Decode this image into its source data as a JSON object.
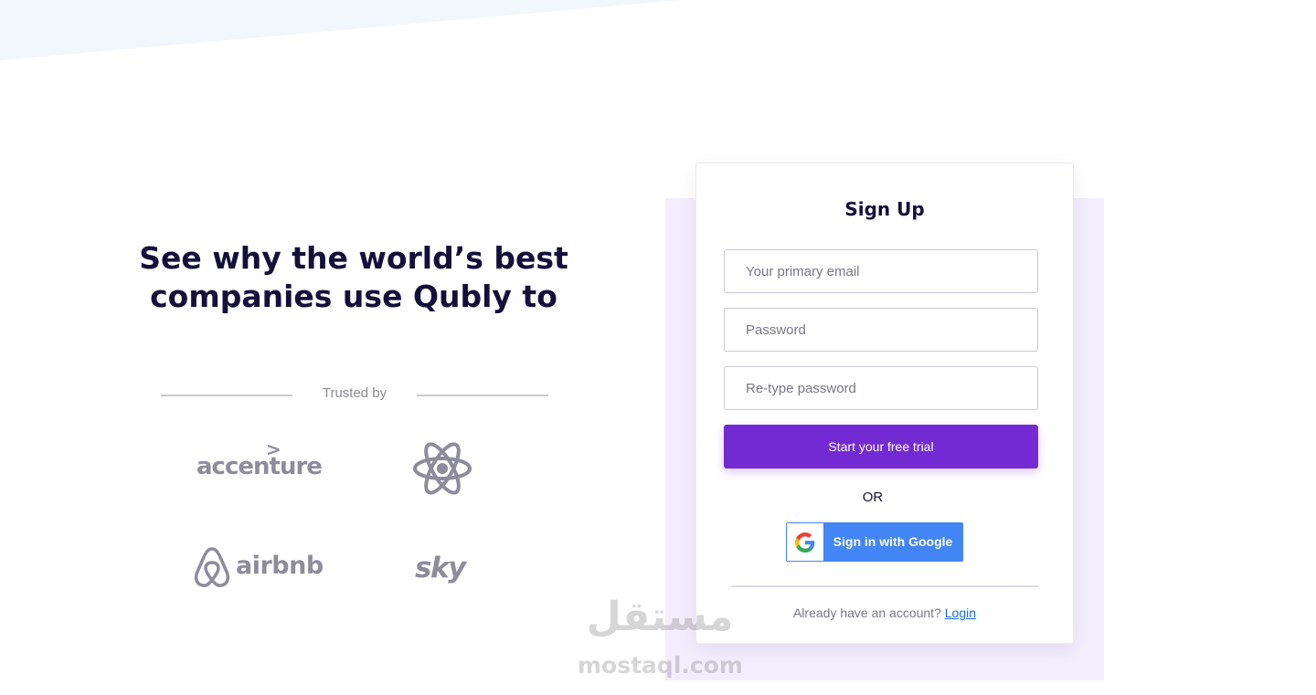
{
  "hero": {
    "title_line1": "See why the world’s best",
    "title_line2": "companies use Qubly to"
  },
  "trusted": {
    "label": "Trusted by",
    "logos": [
      {
        "name": "accenture",
        "icon": "accenture-logo"
      },
      {
        "name": "react",
        "icon": "react-atom-logo"
      },
      {
        "name": "airbnb",
        "icon": "airbnb-logo"
      },
      {
        "name": "sky",
        "icon": "sky-logo"
      }
    ]
  },
  "signup": {
    "title": "Sign Up",
    "email_placeholder": "Your primary email",
    "password_placeholder": "Password",
    "retype_placeholder": "Re-type password",
    "cta_label": "Start your free trial",
    "or_label": "OR",
    "google_label": "Sign in with Google",
    "account_text": "Already have an account?",
    "login_label": "Login"
  },
  "watermark": {
    "arabic": "مستقل",
    "latin": "mostaql.com"
  },
  "colors": {
    "accent": "#742ad2",
    "heading": "#14103a",
    "muted_logo": "#8d8c9c",
    "google_blue": "#4285f4",
    "link": "#1c6ed6",
    "lavender_panel": "#f3eefe"
  }
}
